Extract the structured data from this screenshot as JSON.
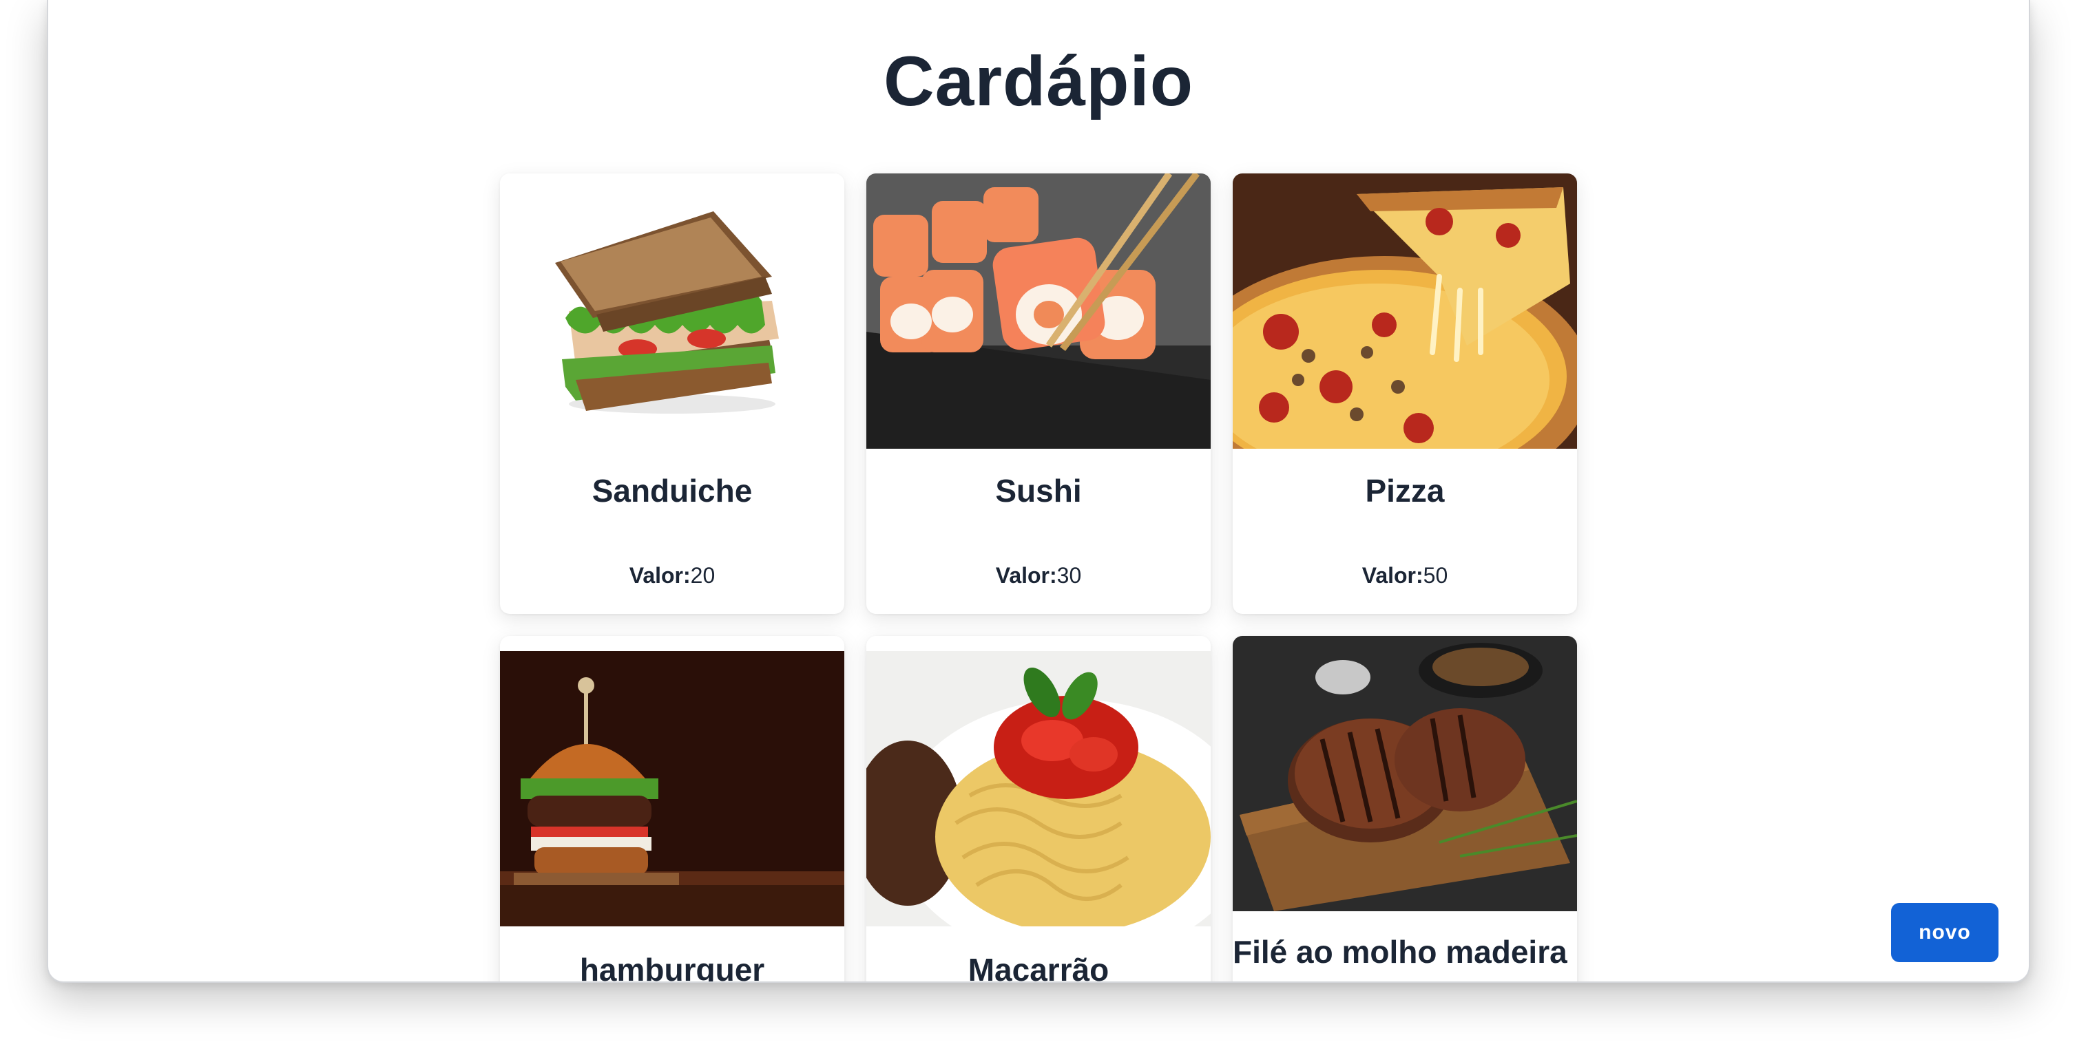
{
  "page": {
    "title": "Cardápio"
  },
  "menu": {
    "price_label": "Valor:",
    "items": [
      {
        "name": "Sanduiche",
        "price": "20",
        "image": "sandwich"
      },
      {
        "name": "Sushi",
        "price": "30",
        "image": "sushi"
      },
      {
        "name": "Pizza",
        "price": "50",
        "image": "pizza"
      },
      {
        "name": "hamburguer",
        "price": "",
        "image": "burger"
      },
      {
        "name": "Macarrão",
        "price": "",
        "image": "pasta"
      },
      {
        "name": "Filé ao molho madeira",
        "price": "",
        "image": "steak"
      }
    ]
  },
  "actions": {
    "new_label": "novo"
  },
  "colors": {
    "primary": "#1262d6",
    "text": "#1b2535"
  }
}
